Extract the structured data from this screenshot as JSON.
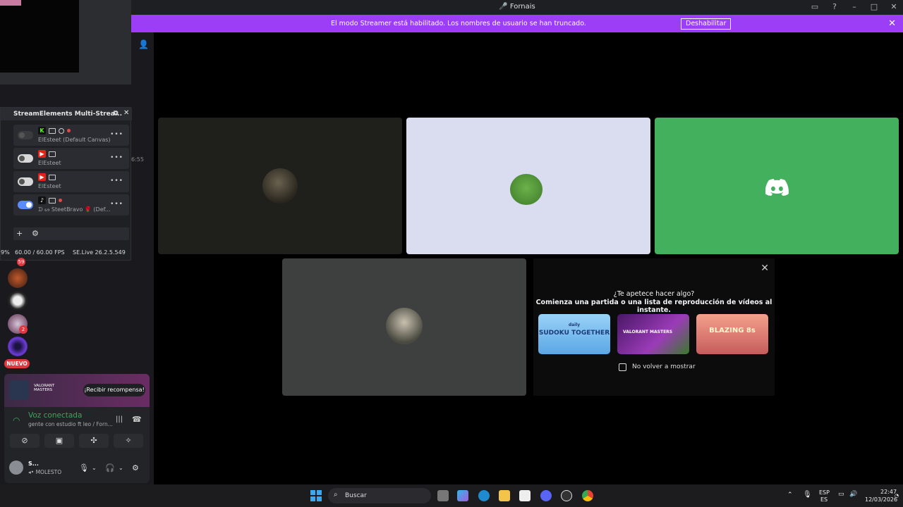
{
  "window": {
    "title": "Fornais"
  },
  "banner": {
    "text": "El modo Streamer está habilitado. Los nombres de usuario se han truncado.",
    "button": "Deshabilitar"
  },
  "streamelements": {
    "title": "StreamElements Multi-Strea...",
    "rows": [
      {
        "label": "ElEsteet (Default Canvas)",
        "platform": "kick",
        "state": "disabled"
      },
      {
        "label": "ElEsteet",
        "platform": "youtube",
        "state": "off"
      },
      {
        "label": "ElEsteet",
        "platform": "youtube",
        "state": "off"
      },
      {
        "label": "SteetBravo 🌹 (Def...",
        "prefix": "ᗪ ᔕ",
        "platform": "tiktok",
        "state": "on"
      }
    ],
    "status": {
      "cpu": "9%",
      "fps": "60.00 / 60.00 FPS",
      "version": "SE.Live 26.2.5.549"
    }
  },
  "sidebar": {
    "time_fragment": "6:55",
    "badges": {
      "top": "59",
      "server3": "2"
    },
    "new_label": "NUEVO"
  },
  "promo": {
    "brand": "VALORANT MASTERS",
    "button": "¡Recibir recompensa!"
  },
  "voice": {
    "status": "Voz conectada",
    "channel": "gente con estudio ft leo / Forn..."
  },
  "user": {
    "name": "S...",
    "status": "MOLESTO"
  },
  "activity": {
    "heading": "¿Te apetece hacer algo?",
    "subheading": "Comienza una partida o una lista de reproducción de vídeos al instante.",
    "games": [
      {
        "name": "SUDOKU TOGETHER",
        "top": "daily",
        "color": "#7ec0f0"
      },
      {
        "name": "VALORANT MASTERS",
        "color": "#7a2a8e"
      },
      {
        "name": "BLAZING 8s",
        "color": "#e7826d"
      }
    ],
    "checkbox_label": "No volver a mostrar"
  },
  "taskbar": {
    "search": "Buscar",
    "lang": "ESP",
    "region": "ES",
    "time": "22:47",
    "date": "12/03/2026"
  },
  "colors": {
    "streamer_banner": "#9b3ef5",
    "discord_green": "#43b05e",
    "voice_green": "#3ba55c"
  }
}
